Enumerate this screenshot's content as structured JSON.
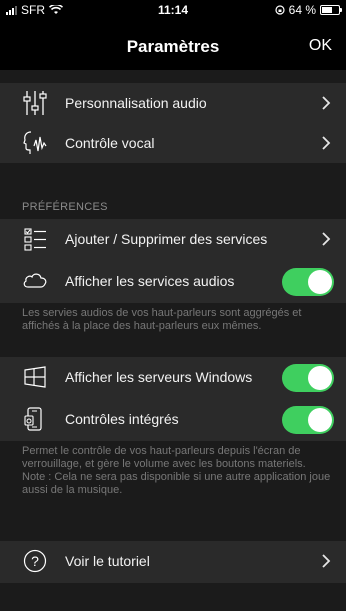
{
  "status": {
    "carrier": "SFR",
    "time": "11:14",
    "battery": "64 %"
  },
  "nav": {
    "title": "Paramètres",
    "ok": "OK"
  },
  "group1": [
    {
      "label": "Personnalisation audio",
      "icon": "equalizer-icon"
    },
    {
      "label": "Contrôle vocal",
      "icon": "voice-icon"
    }
  ],
  "preferences": {
    "header": "PRÉFÉRENCES",
    "add_remove": "Ajouter / Supprimer des services",
    "show_audio": "Afficher les services audios",
    "show_audio_on": true,
    "note": "Les servies audios de vos haut-parleurs sont aggrégés et affichés à la place des haut-parleurs eux mêmes."
  },
  "windows": {
    "show_servers": "Afficher les serveurs Windows",
    "show_servers_on": true,
    "integrated": "Contrôles intégrés",
    "integrated_on": true,
    "note": "Permet le contrôle de vos haut-parleurs depuis l'écran de verrouillage, et gère le volume avec les boutons materiels.\nNote : Cela ne sera pas disponible si une autre application joue aussi de la musique."
  },
  "tutorial": {
    "label": "Voir le tutoriel"
  },
  "colors": {
    "toggle_on": "#3fcf5f",
    "background": "#1b1b1b",
    "row": "#2a2a2a"
  }
}
